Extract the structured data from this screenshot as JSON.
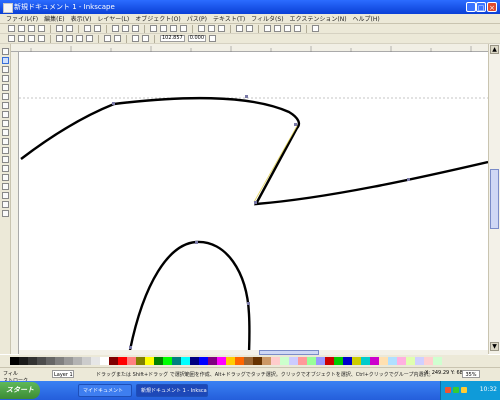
{
  "window": {
    "title": "新規ドキュメント 1 - Inkscape"
  },
  "menu": {
    "items": [
      "ファイル(F)",
      "編集(E)",
      "表示(V)",
      "レイヤー(L)",
      "オブジェクト(O)",
      "パス(P)",
      "テキスト(T)",
      "フィルタ(S)",
      "エクステンション(N)",
      "ヘルプ(H)"
    ]
  },
  "toolbar": {
    "x_field": "102.857",
    "y_field": "0.000"
  },
  "toolbox_colors": {
    "accent": "#2b6cff"
  },
  "canvas": {
    "stroke_color": "#000000",
    "node_color": "#7a7aa8"
  },
  "palette": {
    "colors": [
      "#000000",
      "#1a1a1a",
      "#333333",
      "#4d4d4d",
      "#666666",
      "#808080",
      "#999999",
      "#b3b3b3",
      "#cccccc",
      "#e6e6e6",
      "#ffffff",
      "#800000",
      "#ff0000",
      "#ff8080",
      "#808000",
      "#ffff00",
      "#008000",
      "#00ff00",
      "#008080",
      "#00ffff",
      "#000080",
      "#0000ff",
      "#800080",
      "#ff00ff",
      "#ffcc00",
      "#ff6600",
      "#996633",
      "#663300",
      "#cc9966",
      "#ffcccc",
      "#ccffcc",
      "#ccccff",
      "#ff9999",
      "#99ff99",
      "#9999ff",
      "#cc0000",
      "#00cc00",
      "#0000cc",
      "#cccc00",
      "#00cccc",
      "#cc00cc",
      "#ffe0b0",
      "#b0e0ff",
      "#ffb0e0",
      "#e0ffb0",
      "#d0d0ff",
      "#ffd0d0",
      "#d0ffd0"
    ]
  },
  "status": {
    "fill_label": "フィル",
    "stroke_label": "ストローク",
    "layer": "Layer 1",
    "message": "ドラッグまたは Shift+ドラッグ で選択範囲を作成、Alt+ドラッグでタッチ選択。クリックでオブジェクトを選択、Ctrl+クリックでグループ内選択。",
    "coords": "X: 249.29 Y: 681.43",
    "zoom": "35%"
  },
  "taskbar": {
    "start_label": "スタート",
    "tasks": [
      "マイドキュメント",
      "新規ドキュメント 1 - Inkscape"
    ],
    "clock": "10:32"
  }
}
